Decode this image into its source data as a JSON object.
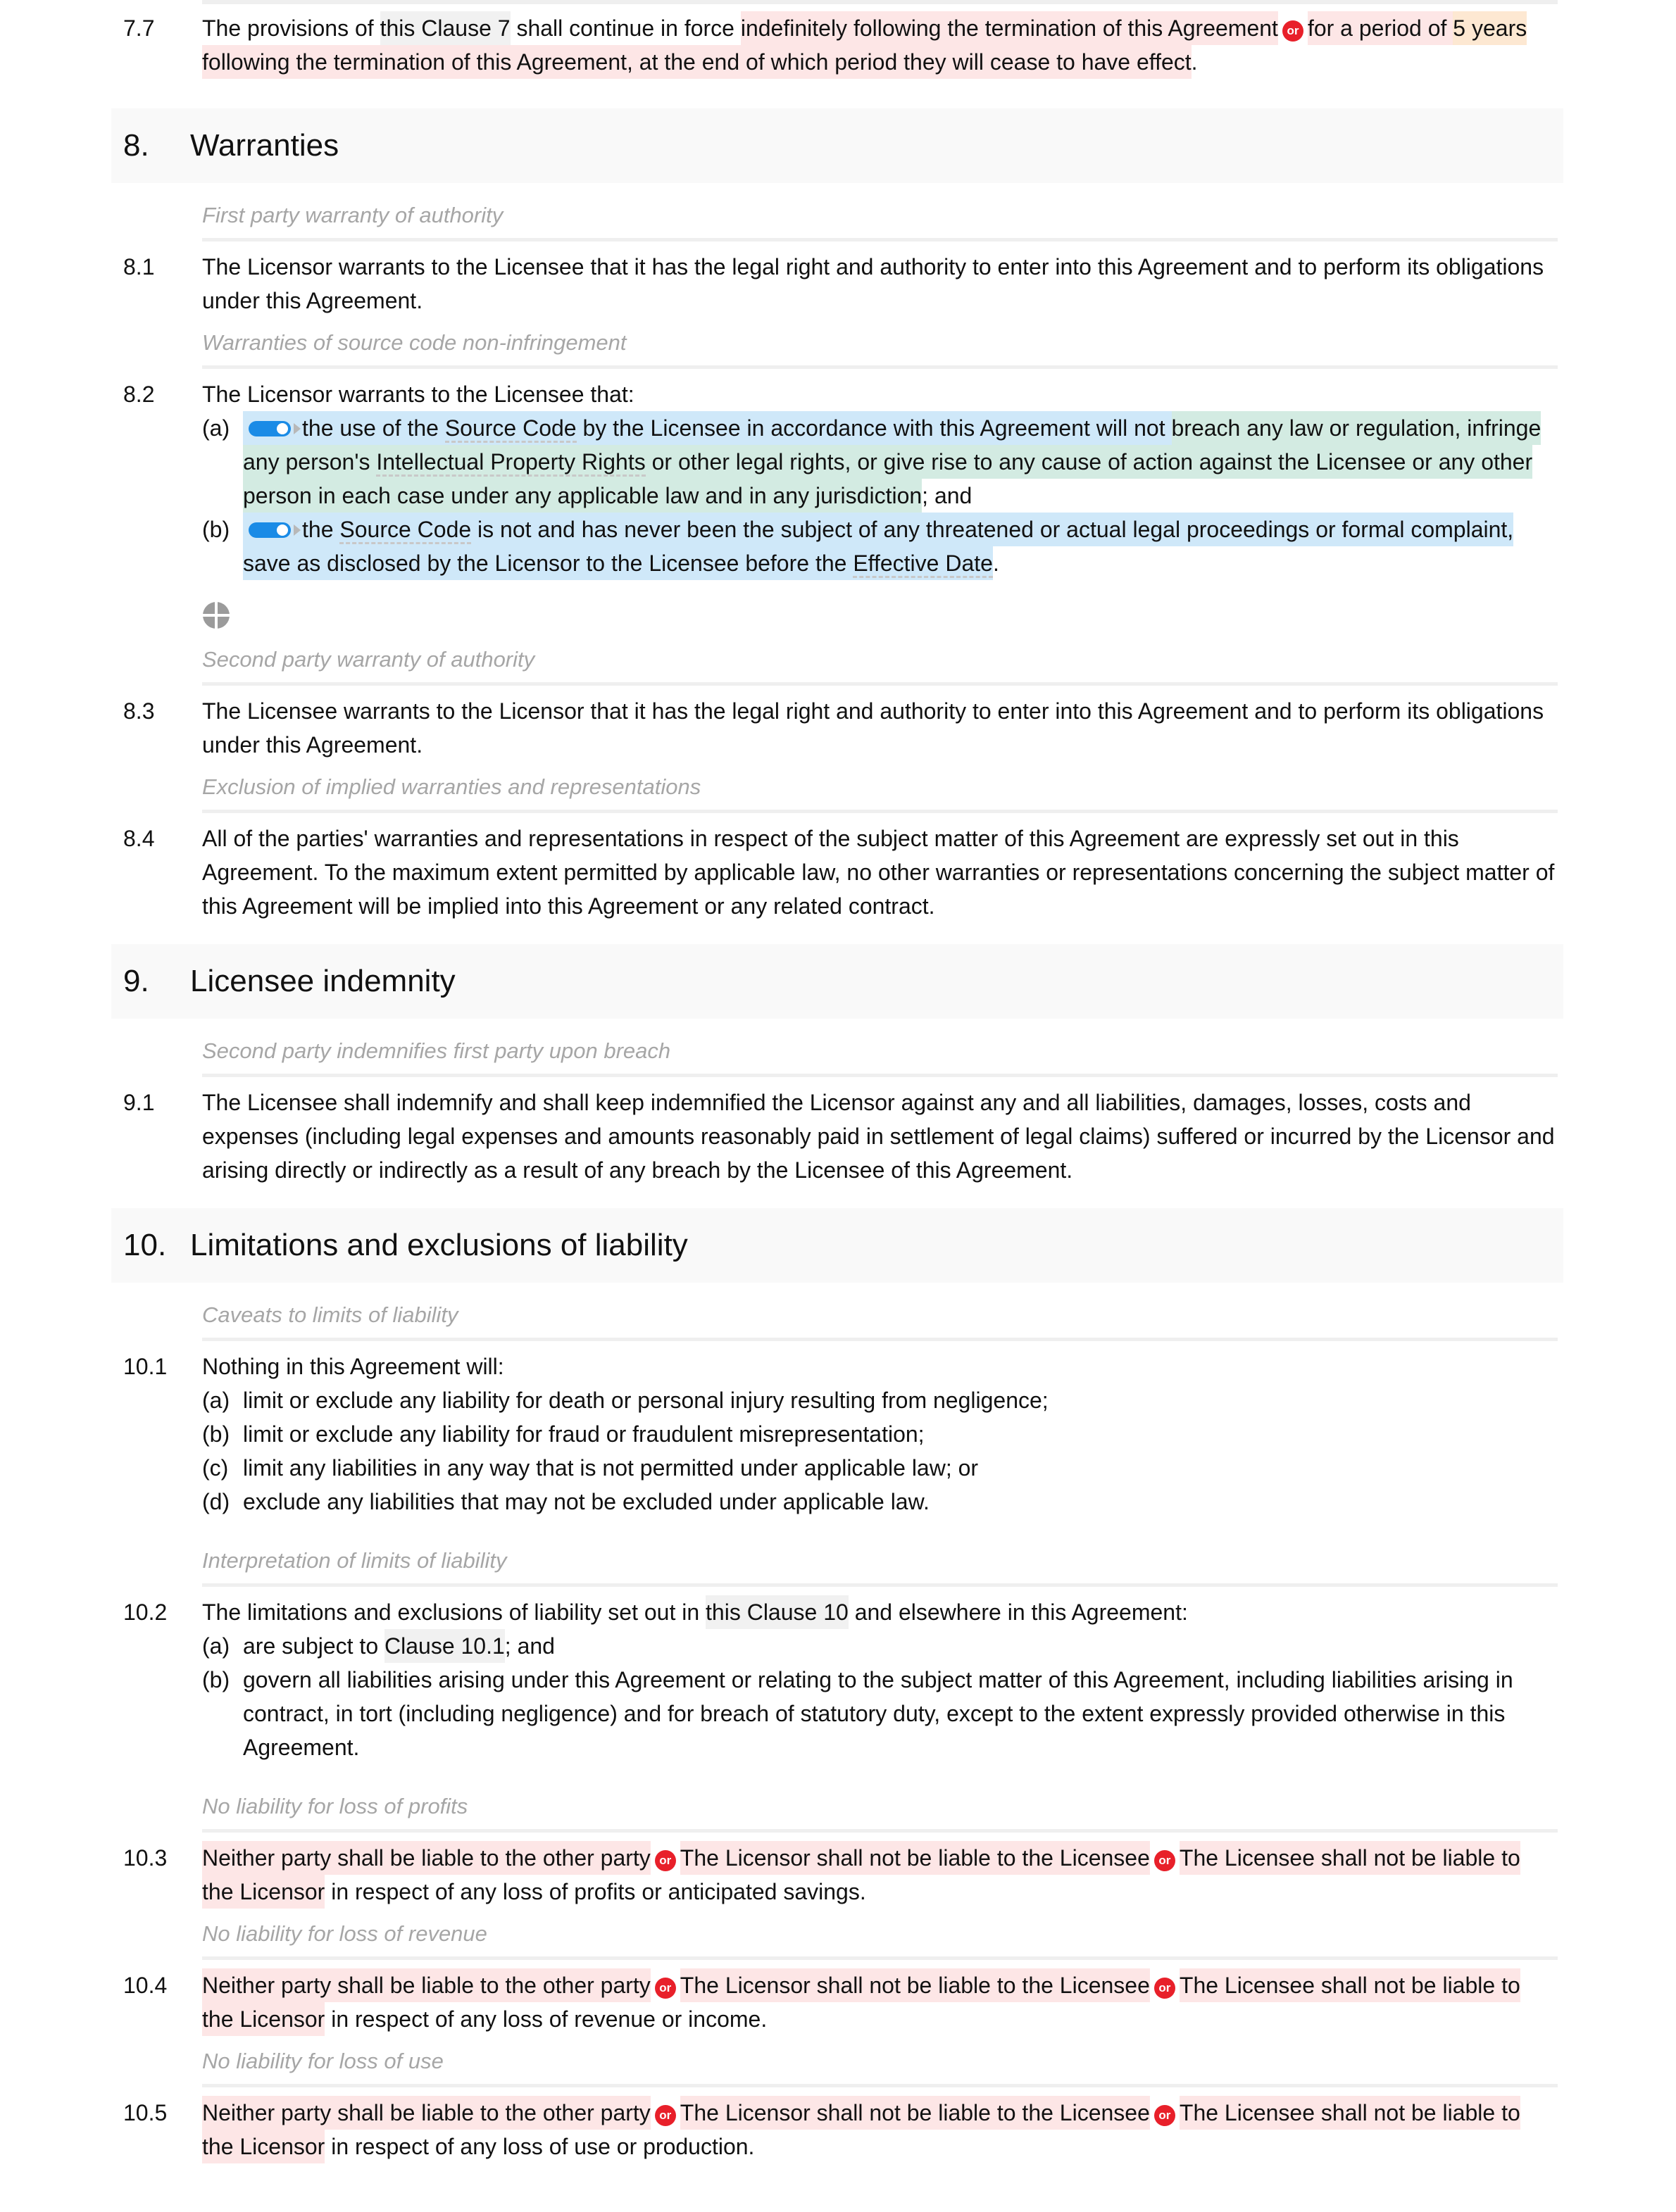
{
  "clause_7_7": {
    "num": "7.7",
    "t1": "The provisions of ",
    "ref": "this Clause 7",
    "t2": " shall continue in force ",
    "opt1": "indefinitely following the termination of this Agreement",
    "or": "or",
    "opt2a": "for a period of ",
    "opt2_value": "5 years",
    "opt2b": " following the termination of this Agreement, at the end of which period they will cease to have effect",
    "end": "."
  },
  "section_8": {
    "num": "8.",
    "title": "Warranties",
    "c1": {
      "caption": "First party warranty of authority",
      "num": "8.1",
      "text": "The Licensor warrants to the Licensee that it has the legal right and authority to enter into this Agreement and to perform its obligations under this Agreement."
    },
    "c2": {
      "caption": "Warranties of source code non-infringement",
      "num": "8.2",
      "intro": "The Licensor warrants to the Licensee that:",
      "a": {
        "label": "(a)",
        "toggle_on": true,
        "t1": "the use of the ",
        "term1": "Source Code",
        "t2": " by the Licensee in accordance with this Agreement will not ",
        "g1": "breach any law or regulation, infringe any person's ",
        "term2": "Intellectual Property Rights",
        "g2": " or other legal rights, or give rise to any cause of action against the Licensee or any other person",
        "g3": " in each case under any applicable law and in any jurisdiction",
        "end": "; and"
      },
      "b": {
        "label": "(b)",
        "toggle_on": true,
        "t1": "the ",
        "term1": "Source Code",
        "t2": " is not and has never been the subject of any threatened or actual legal proceedings or formal complaint, save as disclosed by the Licensor to the Licensee before the ",
        "term2": "Effective Date",
        "end": "."
      }
    },
    "c3": {
      "caption": "Second party warranty of authority",
      "num": "8.3",
      "text": "The Licensee warrants to the Licensor that it has the legal right and authority to enter into this Agreement and to perform its obligations under this Agreement."
    },
    "c4": {
      "caption": "Exclusion of implied warranties and representations",
      "num": "8.4",
      "text": "All of the parties' warranties and representations in respect of the subject matter of this Agreement are expressly set out in this Agreement. To the maximum extent permitted by applicable law, no other warranties or representations concerning the subject matter of this Agreement will be implied into this Agreement or any related contract."
    }
  },
  "section_9": {
    "num": "9.",
    "title": "Licensee indemnity",
    "c1": {
      "caption": "Second party indemnifies first party upon breach",
      "num": "9.1",
      "text": "The Licensee shall indemnify and shall keep indemnified the Licensor against any and all liabilities, damages, losses, costs and expenses (including legal expenses and amounts reasonably paid in settlement of legal claims) suffered or incurred by the Licensor and arising directly or indirectly as a result of any breach by the Licensee of this Agreement."
    }
  },
  "section_10": {
    "num": "10.",
    "title": "Limitations and exclusions of liability",
    "c1": {
      "caption": "Caveats to limits of liability",
      "num": "10.1",
      "intro": "Nothing in this Agreement will:",
      "items": [
        {
          "label": "(a)",
          "text": "limit or exclude any liability for death or personal injury resulting from negligence;"
        },
        {
          "label": "(b)",
          "text": "limit or exclude any liability for fraud or fraudulent misrepresentation;"
        },
        {
          "label": "(c)",
          "text": "limit any liabilities in any way that is not permitted under applicable law; or"
        },
        {
          "label": "(d)",
          "text": "exclude any liabilities that may not be excluded under applicable law."
        }
      ]
    },
    "c2": {
      "caption": "Interpretation of limits of liability",
      "num": "10.2",
      "t1": "The limitations and exclusions of liability set out in ",
      "ref": "this Clause 10",
      "t2": " and elsewhere in this Agreement:",
      "a": {
        "label": "(a)",
        "t1": "are subject to ",
        "ref": "Clause 10.1",
        "t2": "; and"
      },
      "b": {
        "label": "(b)",
        "text": "govern all liabilities arising under this Agreement or relating to the subject matter of this Agreement, including liabilities arising in contract, in tort (including negligence) and for breach of statutory duty, except to the extent expressly provided otherwise in this Agreement."
      }
    },
    "options": {
      "opt1": "Neither party shall be liable to the other party",
      "opt2": "The Licensor shall not be liable to the Licensee",
      "opt3": "The Licensee shall not be liable to the Licensor",
      "or": "or"
    },
    "c3": {
      "caption": "No liability for loss of profits",
      "num": "10.3",
      "tail": " in respect of any loss of profits or anticipated savings."
    },
    "c4": {
      "caption": "No liability for loss of revenue",
      "num": "10.4",
      "tail": " in respect of any loss of revenue or income."
    },
    "c5": {
      "caption": "No liability for loss of use",
      "num": "10.5",
      "tail": " in respect of any loss of use or production."
    }
  },
  "icons": {
    "or_badge": "or-choice-badge",
    "toggle": "toggle-switch-on",
    "add": "add-clause-icon"
  },
  "colors": {
    "option_highlight": "#fde6e6",
    "variable_highlight": "#fde8d2",
    "reference_highlight": "#f1f1f1",
    "toggle_highlight": "#cfe8f9",
    "nested_highlight": "#d3ebe2",
    "or_badge": "#e8202a",
    "toggle": "#1a8be6",
    "caption_text": "#a6a6a6"
  }
}
